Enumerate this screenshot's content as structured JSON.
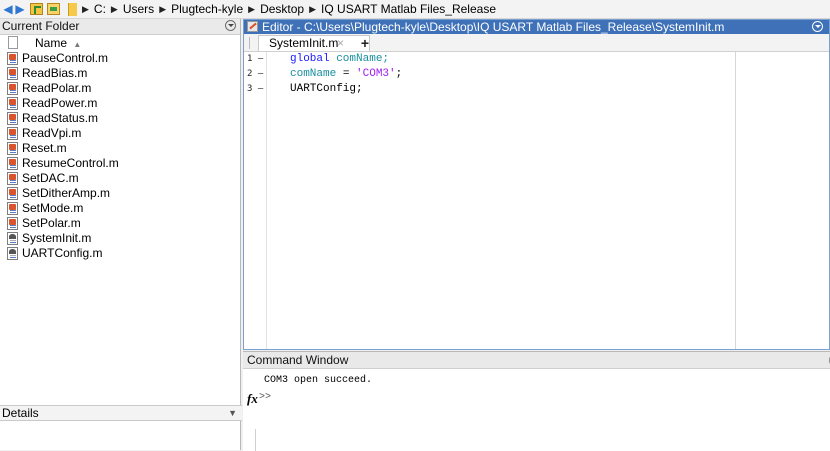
{
  "address_bar": {
    "breadcrumbs": [
      "C:",
      "Users",
      "Plugtech-kyle",
      "Desktop",
      "IQ USART Matlab Files_Release"
    ]
  },
  "folder_panel": {
    "title": "Current Folder",
    "column_header": "Name",
    "sort_indicator": "▲",
    "files": [
      {
        "name": "PauseControl.m",
        "kind": "function"
      },
      {
        "name": "ReadBias.m",
        "kind": "function"
      },
      {
        "name": "ReadPolar.m",
        "kind": "function"
      },
      {
        "name": "ReadPower.m",
        "kind": "function"
      },
      {
        "name": "ReadStatus.m",
        "kind": "function"
      },
      {
        "name": "ReadVpi.m",
        "kind": "function"
      },
      {
        "name": "Reset.m",
        "kind": "function"
      },
      {
        "name": "ResumeControl.m",
        "kind": "function"
      },
      {
        "name": "SetDAC.m",
        "kind": "function"
      },
      {
        "name": "SetDitherAmp.m",
        "kind": "function"
      },
      {
        "name": "SetMode.m",
        "kind": "function"
      },
      {
        "name": "SetPolar.m",
        "kind": "function"
      },
      {
        "name": "SystemInit.m",
        "kind": "script"
      },
      {
        "name": "UARTConfig.m",
        "kind": "script"
      }
    ],
    "details_label": "Details"
  },
  "editor": {
    "title": "Editor - C:\\Users\\Plugtech-kyle\\Desktop\\IQ USART Matlab Files_Release\\SystemInit.m",
    "tab_label": "SystemInit.m",
    "tab_close": "×",
    "tab_add": "+",
    "line_numbers": [
      "1 —",
      "2 —",
      "3 —"
    ],
    "code": {
      "line1_kw": "global",
      "line1_rest": " comName;",
      "line2_var": "comName",
      "line2_eq": " = ",
      "line2_str": "'COM3'",
      "line2_end": ";",
      "line3": "UARTConfig;"
    }
  },
  "command_window": {
    "title": "Command Window",
    "edge_glyph": "(",
    "output": "COM3 open succeed.",
    "fx": "fx",
    "prompt": ">>"
  }
}
